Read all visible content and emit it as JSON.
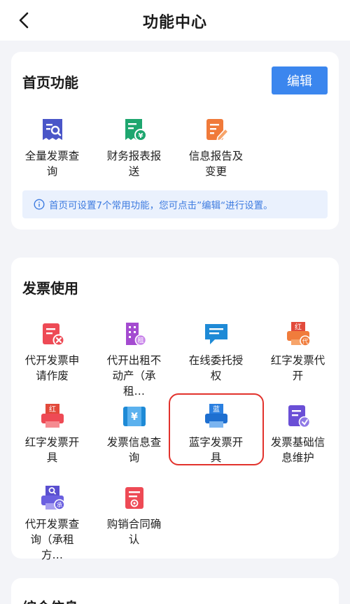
{
  "header": {
    "title": "功能中心"
  },
  "home": {
    "title": "首页功能",
    "edit_label": "编辑",
    "tip": "首页可设置7个常用功能，您可点击”编辑“进行设置。",
    "items": [
      {
        "label": "全量发票查询",
        "icon": "invoice-search-icon"
      },
      {
        "label": "财务报表报送",
        "icon": "financial-report-icon"
      },
      {
        "label": "信息报告及变更",
        "icon": "report-edit-icon"
      }
    ]
  },
  "invoice": {
    "title": "发票使用",
    "items": [
      {
        "label": "代开发票申请作废",
        "icon": "invoice-void-icon"
      },
      {
        "label": "代开出租不动产（承租…",
        "icon": "building-rent-icon"
      },
      {
        "label": "在线委托授权",
        "icon": "chat-authorize-icon"
      },
      {
        "label": "红字发票代开",
        "icon": "red-invoice-proxy-icon"
      },
      {
        "label": "红字发票开具",
        "icon": "red-invoice-printer-icon"
      },
      {
        "label": "发票信息查询",
        "icon": "invoice-info-icon"
      },
      {
        "label": "蓝字发票开具",
        "icon": "blue-invoice-printer-icon"
      },
      {
        "label": "发票基础信息维护",
        "icon": "invoice-maintain-icon"
      },
      {
        "label": "代开发票查询（承租方…",
        "icon": "proxy-invoice-search-icon"
      },
      {
        "label": "购销合同确认",
        "icon": "contract-confirm-icon"
      }
    ]
  },
  "general": {
    "title": "综合信息"
  },
  "colors": {
    "primary": "#3b86ee",
    "highlight": "#e2322c"
  }
}
